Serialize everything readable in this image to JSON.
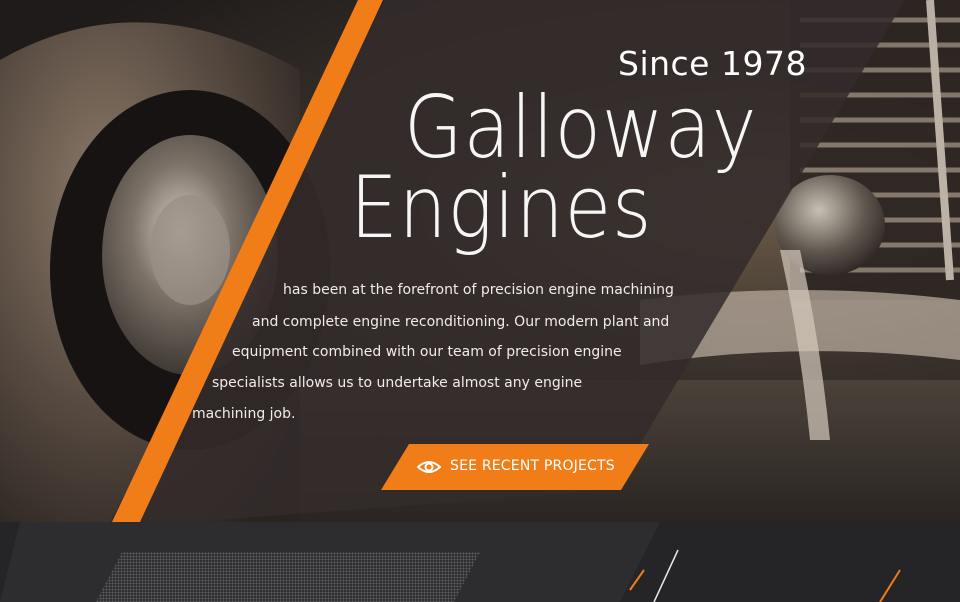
{
  "hero": {
    "since": "Since 1978",
    "title_line1": "Galloway",
    "title_line2": "Engines",
    "description_lines": [
      "has been at the forefront of precision engine machining",
      "and complete engine reconditioning. Our modern plant and",
      "equipment combined with our team of precision engine",
      "specialists allows us to undertake almost any engine",
      "machining job."
    ],
    "cta": {
      "label": "SEE RECENT PROJECTS",
      "icon": "eye-icon"
    }
  },
  "colors": {
    "accent": "#f07d18",
    "text": "#ffffff",
    "bottom_bar": "#252527",
    "panel": "#2a2427"
  }
}
